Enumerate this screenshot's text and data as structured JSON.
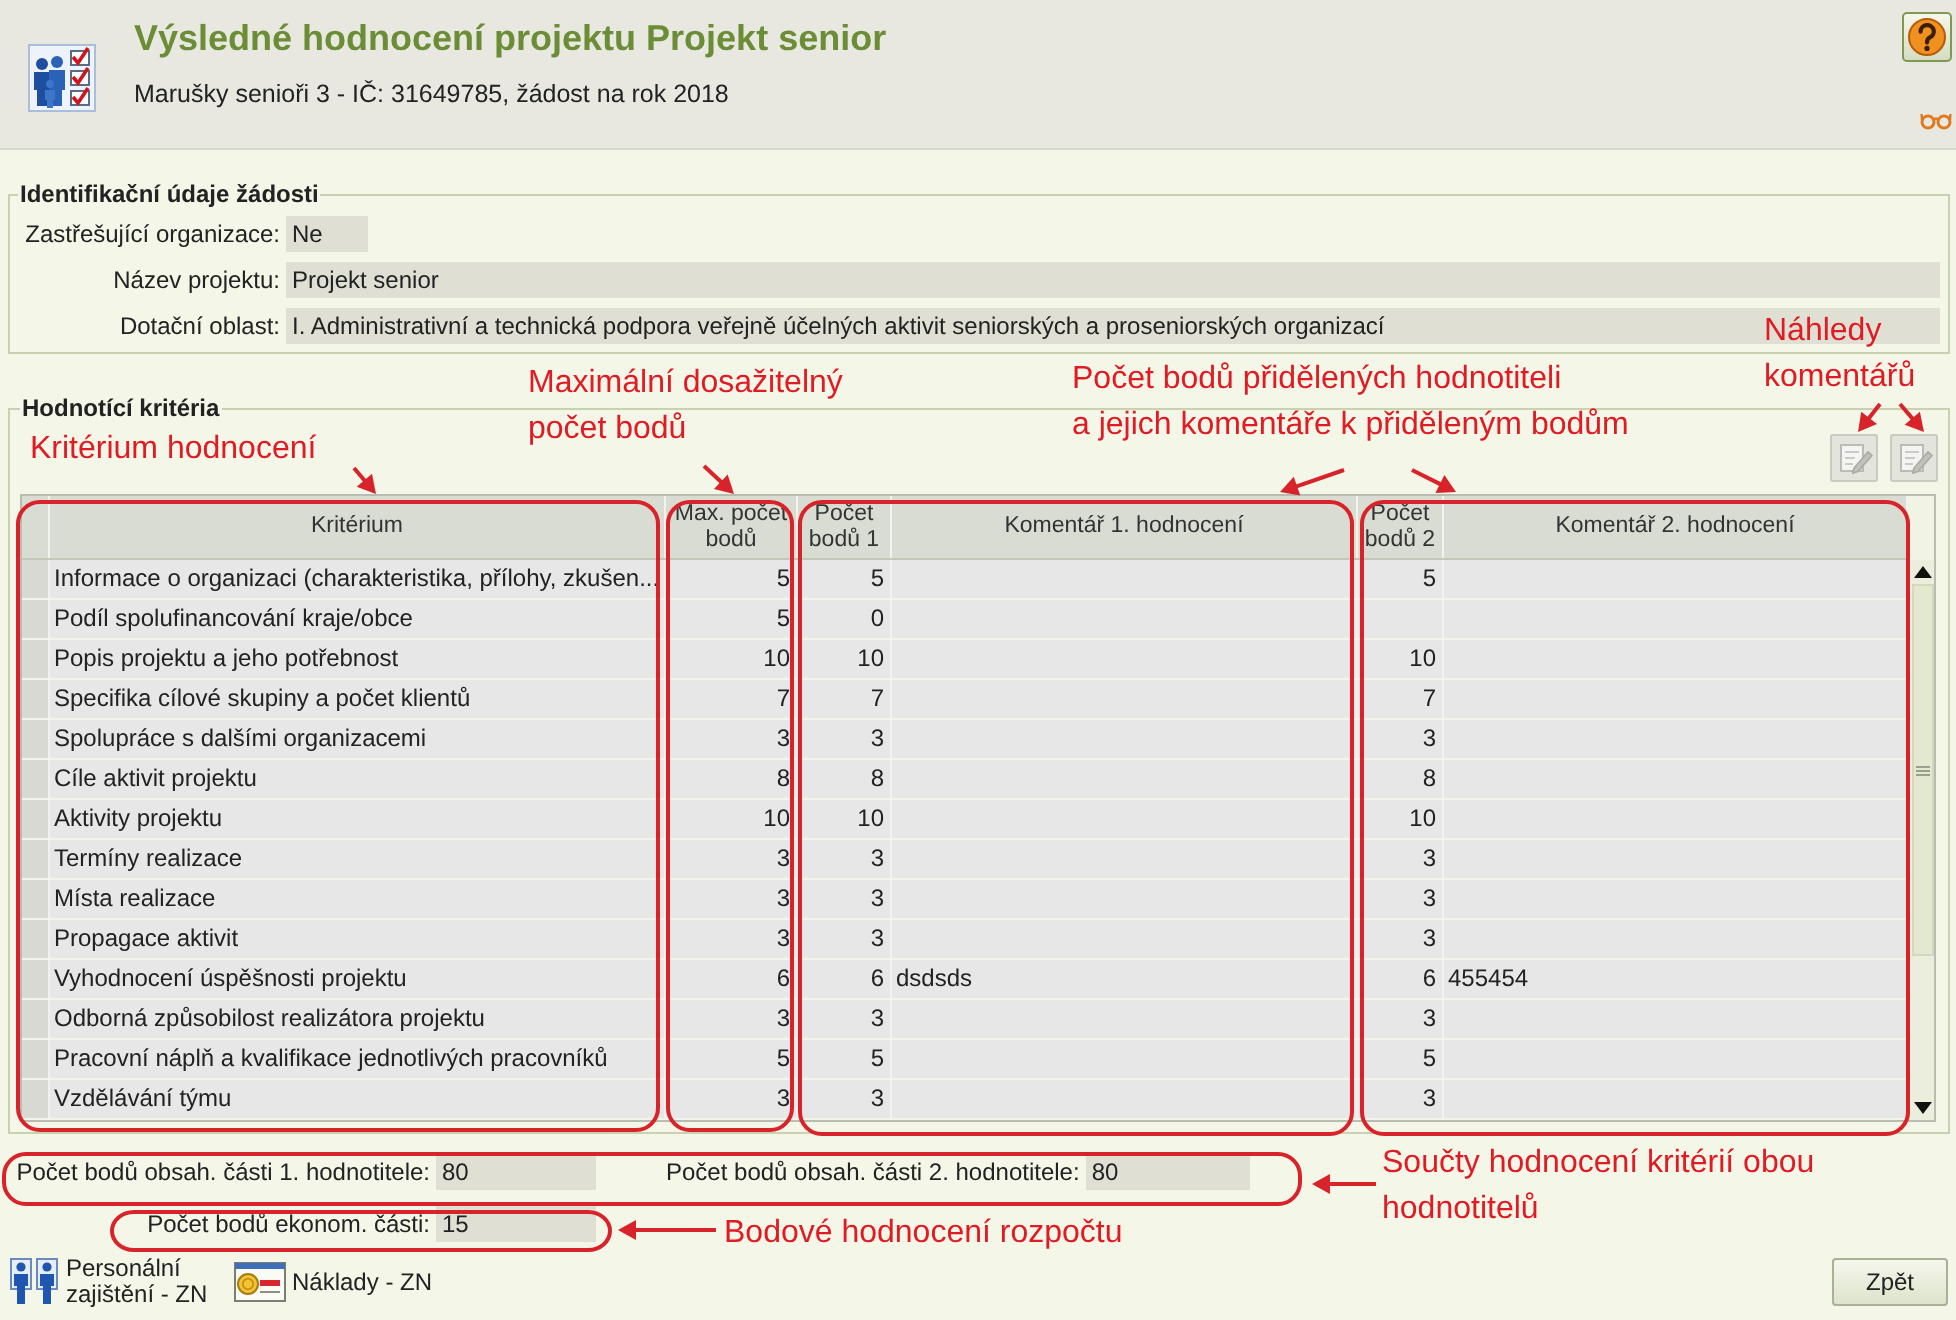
{
  "header": {
    "title": "Výsledné hodnocení projektu Projekt senior",
    "subtitle": "Marušky senioři 3 - IČ: 31649785, žádost na rok 2018"
  },
  "identification": {
    "legend": "Identifikační údaje žádosti",
    "fields": [
      {
        "label": "Zastřešující organizace:",
        "value": "Ne",
        "kind": "short"
      },
      {
        "label": "Název projektu:",
        "value": "Projekt senior",
        "kind": "wide"
      },
      {
        "label": "Dotační oblast:",
        "value": "I. Administrativní a technická podpora veřejně účelných aktivit seniorských a proseniorských organizací",
        "kind": "wide"
      }
    ]
  },
  "criteria": {
    "legend": "Hodnotící kritéria",
    "preview_buttons": [
      {
        "disabled": true
      },
      {
        "disabled": true
      }
    ],
    "table": {
      "columns": [
        "Kritérium",
        "Max. počet bodů",
        "Počet bodů 1",
        "Komentář 1. hodnocení",
        "Počet bodů 2",
        "Komentář 2. hodnocení"
      ],
      "rows": [
        {
          "criterion": "Informace o organizaci (charakteristika, přílohy, zkušen...",
          "max_points": "5",
          "points_1": "5",
          "points_2": "5"
        },
        {
          "criterion": "Podíl spolufinancování kraje/obce",
          "max_points": "5",
          "points_1": "0"
        },
        {
          "criterion": "Popis projektu a jeho potřebnost",
          "max_points": "10",
          "points_1": "10",
          "points_2": "10"
        },
        {
          "criterion": "Specifika cílové skupiny a počet klientů",
          "max_points": "7",
          "points_1": "7",
          "points_2": "7"
        },
        {
          "criterion": "Spolupráce s dalšími organizacemi",
          "max_points": "3",
          "points_1": "3",
          "points_2": "3"
        },
        {
          "criterion": "Cíle aktivit projektu",
          "max_points": "8",
          "points_1": "8",
          "points_2": "8"
        },
        {
          "criterion": "Aktivity projektu",
          "max_points": "10",
          "points_1": "10",
          "points_2": "10"
        },
        {
          "criterion": "Termíny realizace",
          "max_points": "3",
          "points_1": "3",
          "points_2": "3"
        },
        {
          "criterion": "Místa realizace",
          "max_points": "3",
          "points_1": "3",
          "points_2": "3"
        },
        {
          "criterion": "Propagace aktivit",
          "max_points": "3",
          "points_1": "3",
          "points_2": "3"
        },
        {
          "criterion": "Vyhodnocení úspěšnosti projektu",
          "max_points": "6",
          "points_1": "6",
          "comment_1": "dsdsds",
          "points_2": "6",
          "comment_2": "455454"
        },
        {
          "criterion": "Odborná způsobilost realizátora projektu",
          "max_points": "3",
          "points_1": "3",
          "points_2": "3"
        },
        {
          "criterion": "Pracovní náplň a kvalifikace jednotlivých pracovníků",
          "max_points": "5",
          "points_1": "5",
          "points_2": "5"
        },
        {
          "criterion": "Vzdělávání týmu",
          "max_points": "3",
          "points_1": "3",
          "points_2": "3"
        }
      ]
    }
  },
  "totals": [
    {
      "items": [
        {
          "label": "Počet bodů obsah. části 1. hodnotitele:",
          "value": "80"
        },
        {
          "label": "Počet bodů obsah. části 2. hodnotitele:",
          "value": "80"
        }
      ]
    },
    {
      "items": [
        {
          "label": "Počet bodů ekonom. části:",
          "value": "15"
        }
      ]
    }
  ],
  "footer": {
    "links": [
      {
        "label": "Personální zajištění - ZN",
        "kind": "staff"
      },
      {
        "label": "Náklady - ZN",
        "kind": "costs"
      }
    ],
    "back_button": "Zpět"
  },
  "annotations": [
    {
      "text": "Kritérium hodnocení"
    },
    {
      "text": "Maximální dosažitelný\npočet bodů"
    },
    {
      "text": "Počet bodů přidělených hodnotiteli\na jejich komentáře k přiděleným bodům"
    },
    {
      "text": "Náhledy\nkomentářů"
    },
    {
      "text": "Součty hodnocení kritérií obou\nhodnotitelů"
    },
    {
      "text": "Bodové hodnocení rozpočtu"
    }
  ]
}
